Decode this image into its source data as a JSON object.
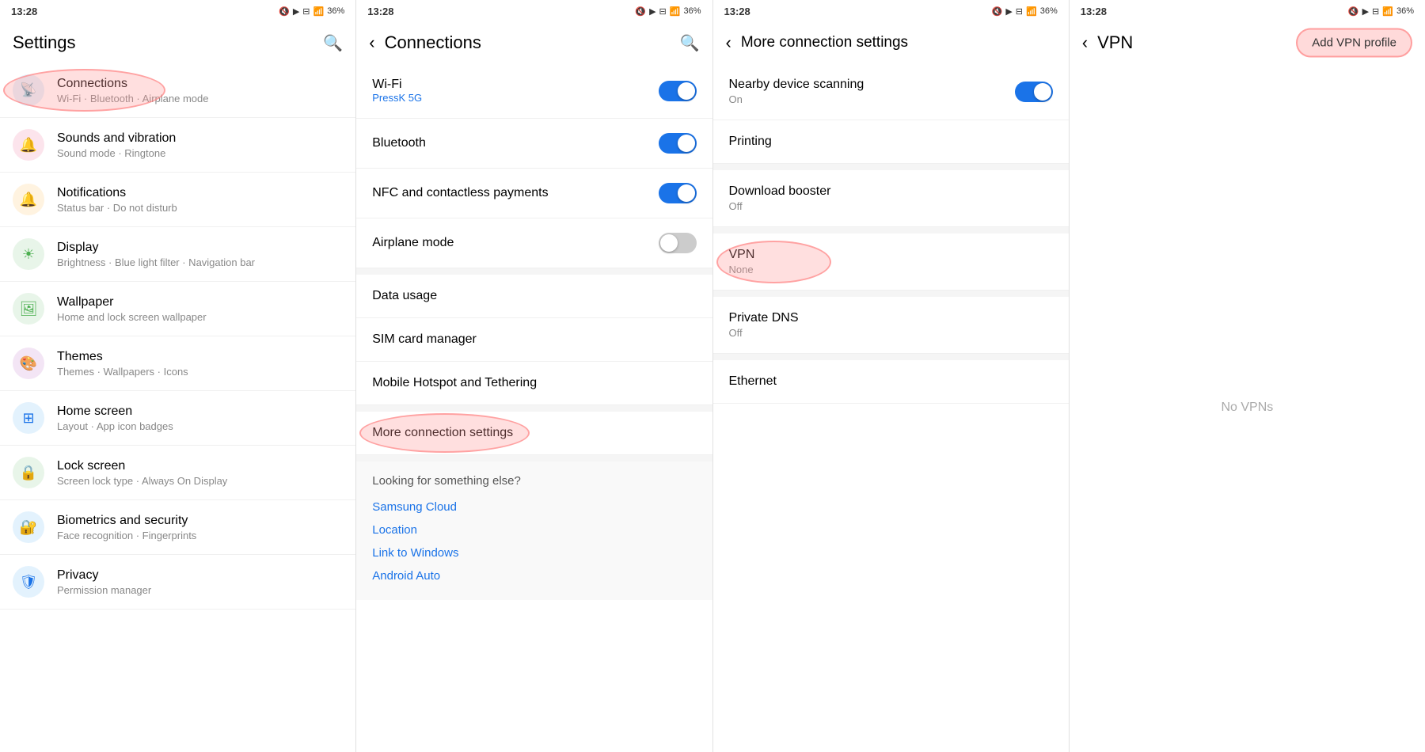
{
  "panel1": {
    "statusBar": {
      "time": "13:28",
      "icons": "🔇 📶 📶 36%"
    },
    "title": "Settings",
    "searchIcon": "🔍",
    "items": [
      {
        "id": "connections",
        "icon": "📡",
        "iconBg": "#e3f2fd",
        "title": "Connections",
        "subtitle": "Wi-Fi · Bluetooth · Airplane mode",
        "highlighted": true
      },
      {
        "id": "sounds",
        "icon": "🔔",
        "iconBg": "#fce4ec",
        "title": "Sounds and vibration",
        "subtitle": "Sound mode · Ringtone",
        "highlighted": false
      },
      {
        "id": "notifications",
        "icon": "🔔",
        "iconBg": "#fff3e0",
        "title": "Notifications",
        "subtitle": "Status bar · Do not disturb",
        "highlighted": false
      },
      {
        "id": "display",
        "icon": "☀️",
        "iconBg": "#e8f5e9",
        "title": "Display",
        "subtitle": "Brightness · Blue light filter · Navigation bar",
        "highlighted": false
      },
      {
        "id": "wallpaper",
        "icon": "🖼️",
        "iconBg": "#e8f5e9",
        "title": "Wallpaper",
        "subtitle": "Home and lock screen wallpaper",
        "highlighted": false
      },
      {
        "id": "themes",
        "icon": "🎨",
        "iconBg": "#f3e5f5",
        "title": "Themes",
        "subtitle": "Themes · Wallpapers · Icons",
        "highlighted": false
      },
      {
        "id": "homescreen",
        "icon": "🏠",
        "iconBg": "#e3f2fd",
        "title": "Home screen",
        "subtitle": "Layout · App icon badges",
        "highlighted": false
      },
      {
        "id": "lockscreen",
        "icon": "🔒",
        "iconBg": "#e8f5e9",
        "title": "Lock screen",
        "subtitle": "Screen lock type · Always On Display",
        "highlighted": false
      },
      {
        "id": "biometrics",
        "icon": "🔐",
        "iconBg": "#e3f2fd",
        "title": "Biometrics and security",
        "subtitle": "Face recognition · Fingerprints",
        "highlighted": false
      },
      {
        "id": "privacy",
        "icon": "🛡️",
        "iconBg": "#e3f2fd",
        "title": "Privacy",
        "subtitle": "Permission manager",
        "highlighted": false
      }
    ]
  },
  "panel2": {
    "statusBar": {
      "time": "13:28",
      "icons": "🔇 📶 📶 36%"
    },
    "backLabel": "‹",
    "title": "Connections",
    "searchIcon": "🔍",
    "items": [
      {
        "id": "wifi",
        "label": "Wi-Fi",
        "sublabel": "PressK 5G",
        "toggleOn": true,
        "hasSublabel": true
      },
      {
        "id": "bluetooth",
        "label": "Bluetooth",
        "sublabel": "",
        "toggleOn": true,
        "hasSublabel": false
      },
      {
        "id": "nfc",
        "label": "NFC and contactless payments",
        "sublabel": "",
        "toggleOn": true,
        "hasSublabel": false
      },
      {
        "id": "airplane",
        "label": "Airplane mode",
        "sublabel": "",
        "toggleOn": false,
        "hasSublabel": false
      }
    ],
    "menuItems": [
      {
        "id": "datausage",
        "label": "Data usage"
      },
      {
        "id": "simcard",
        "label": "SIM card manager"
      },
      {
        "id": "hotspot",
        "label": "Mobile Hotspot and Tethering"
      },
      {
        "id": "moreconn",
        "label": "More connection settings",
        "highlighted": true
      }
    ],
    "lookingSection": {
      "title": "Looking for something else?",
      "links": [
        {
          "id": "samsungcloud",
          "label": "Samsung Cloud"
        },
        {
          "id": "location",
          "label": "Location"
        },
        {
          "id": "linktowindows",
          "label": "Link to Windows"
        },
        {
          "id": "androidauto",
          "label": "Android Auto"
        }
      ]
    }
  },
  "panel3": {
    "statusBar": {
      "time": "13:28",
      "icons": "🔇 📶 📶 36%"
    },
    "backLabel": "‹",
    "title": "More connection settings",
    "items": [
      {
        "id": "nearbydevice",
        "label": "Nearby device scanning",
        "sublabel": "On",
        "hasToggle": true,
        "toggleOn": true
      },
      {
        "id": "printing",
        "label": "Printing",
        "sublabel": "",
        "hasToggle": false
      },
      {
        "id": "downloadbooster",
        "label": "Download booster",
        "sublabel": "Off",
        "hasToggle": false
      },
      {
        "id": "vpn",
        "label": "VPN",
        "sublabel": "None",
        "hasToggle": false,
        "highlighted": true
      },
      {
        "id": "privatedns",
        "label": "Private DNS",
        "sublabel": "Off",
        "hasToggle": false
      },
      {
        "id": "ethernet",
        "label": "Ethernet",
        "sublabel": "",
        "hasToggle": false
      }
    ]
  },
  "panel4": {
    "statusBar": {
      "time": "13:28",
      "icons": "🔇 📶 📶 36%"
    },
    "backLabel": "‹",
    "title": "VPN",
    "addVpnLabel": "Add VPN profile",
    "emptyLabel": "No VPNs"
  },
  "icons": {
    "connections": "📡",
    "sounds": "🔔",
    "notifications": "🔔",
    "display": "☀",
    "wallpaper": "🖼",
    "themes": "🎨",
    "homescreen": "⊞",
    "lockscreen": "🔒",
    "biometrics": "🔐",
    "privacy": "🛡"
  }
}
